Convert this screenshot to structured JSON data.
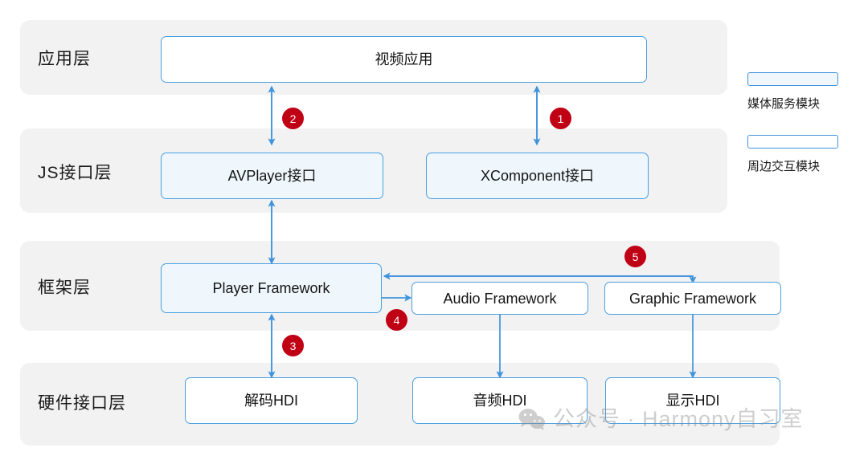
{
  "diagram": {
    "layers": [
      {
        "id": "app",
        "label": "应用层"
      },
      {
        "id": "js",
        "label": "JS接口层"
      },
      {
        "id": "framework",
        "label": "框架层"
      },
      {
        "id": "hdi",
        "label": "硬件接口层"
      }
    ],
    "boxes": [
      {
        "id": "video-app",
        "label": "视频应用",
        "kind": "peripheral"
      },
      {
        "id": "avplayer-api",
        "label": "AVPlayer接口",
        "kind": "media"
      },
      {
        "id": "xcomponent-api",
        "label": "XComponent接口",
        "kind": "media"
      },
      {
        "id": "player-framework",
        "label": "Player Framework",
        "kind": "media"
      },
      {
        "id": "audio-framework",
        "label": "Audio Framework",
        "kind": "peripheral"
      },
      {
        "id": "graphic-framework",
        "label": "Graphic Framework",
        "kind": "peripheral"
      },
      {
        "id": "decode-hdi",
        "label": "解码HDI",
        "kind": "peripheral"
      },
      {
        "id": "audio-hdi",
        "label": "音频HDI",
        "kind": "peripheral"
      },
      {
        "id": "display-hdi",
        "label": "显示HDI",
        "kind": "peripheral"
      }
    ],
    "badges": [
      {
        "id": "badge-1",
        "label": "1"
      },
      {
        "id": "badge-2",
        "label": "2"
      },
      {
        "id": "badge-3",
        "label": "3"
      },
      {
        "id": "badge-4",
        "label": "4"
      },
      {
        "id": "badge-5",
        "label": "5"
      }
    ],
    "legend": [
      {
        "id": "media",
        "label": "媒体服务模块",
        "swatch_color": "#eff7fd"
      },
      {
        "id": "peripheral",
        "label": "周边交互模块",
        "swatch_color": "#ffffff"
      }
    ],
    "colors": {
      "band_background": "#f2f2f2",
      "box_border": "#4a9fe0",
      "media_fill": "#eff7fd",
      "peripheral_fill": "#ffffff",
      "connector": "#4a9fe0",
      "badge": "#c00014",
      "text": "#1a1a1a"
    }
  },
  "watermark": {
    "icon": "wechat-icon",
    "text": "公众号 · Harmony自习室"
  }
}
